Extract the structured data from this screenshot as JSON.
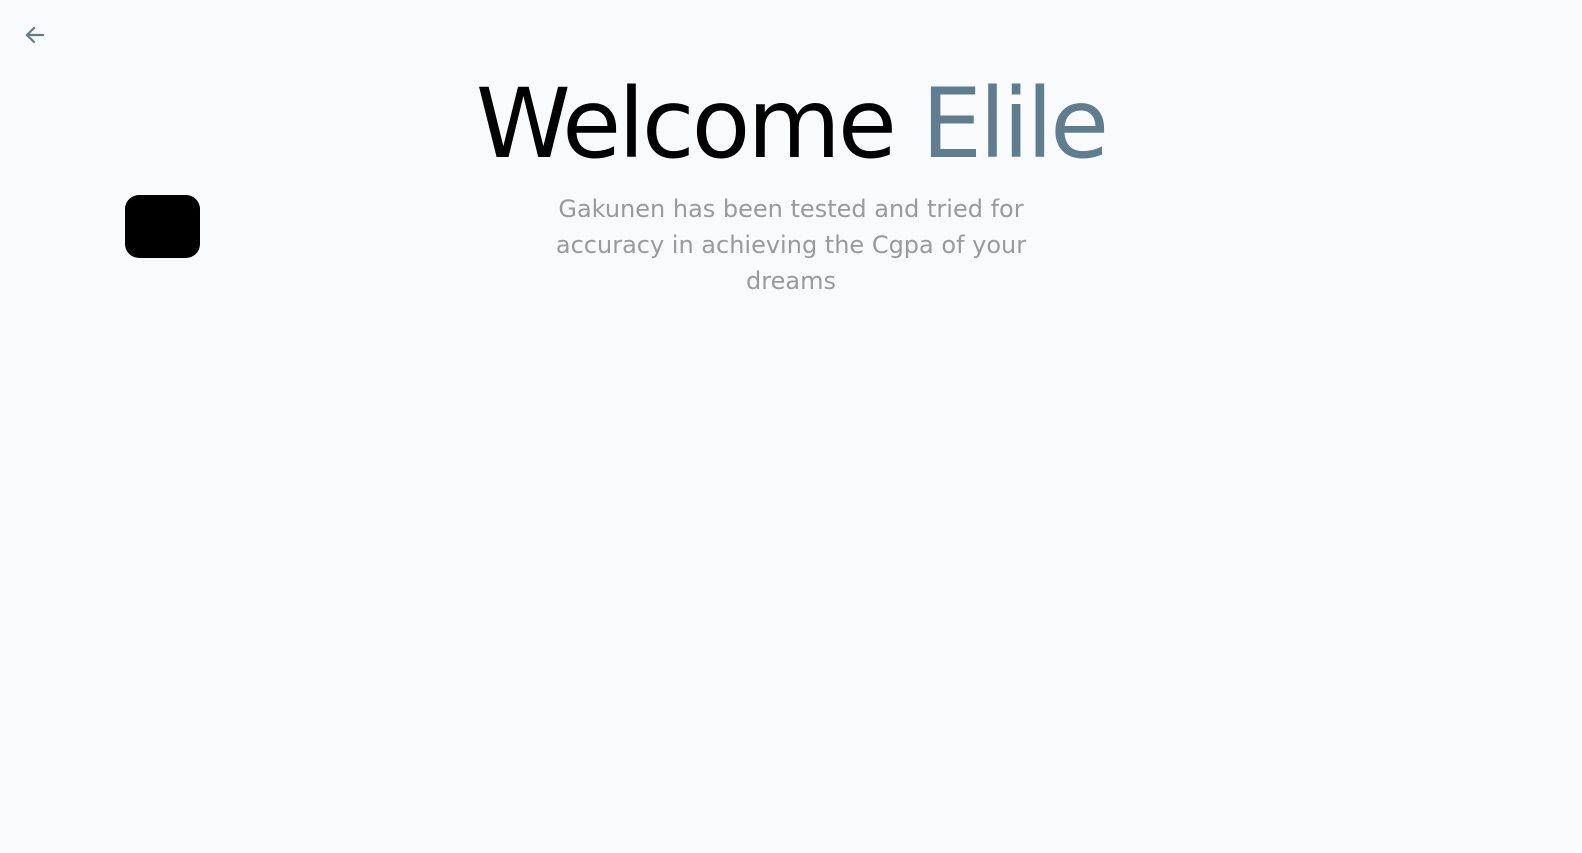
{
  "nav": {
    "back_icon": "arrow-left-icon"
  },
  "hero": {
    "welcome_text": "Welcome",
    "name_text": "Elile",
    "description": "Gakunen has been tested and tried for accuracy in achieving the Cgpa of your dreams"
  },
  "colors": {
    "background": "#f9fafb",
    "title": "#000000",
    "accent": "#5f7d8e",
    "subtitle": "#9a9a9a",
    "tile": "#000000"
  }
}
